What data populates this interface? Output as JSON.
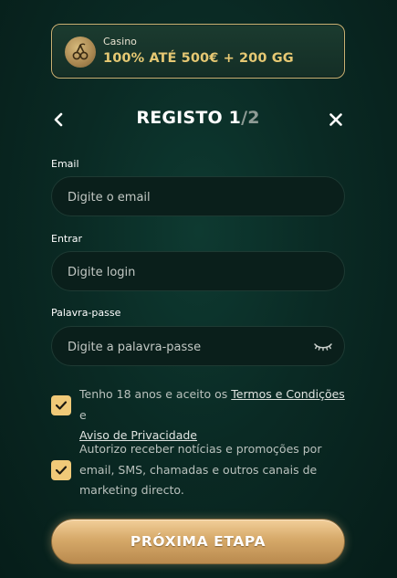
{
  "promo": {
    "caption": "Casino",
    "title": "100% ATÉ 500€ + 200 GG",
    "icon": "cherry-icon"
  },
  "header": {
    "title_step": "REGISTO 1",
    "title_total": "/2",
    "back_icon": "chevron-left-icon",
    "close_icon": "close-icon"
  },
  "form": {
    "email": {
      "label": "Email",
      "placeholder": "Digite o email",
      "value": ""
    },
    "login": {
      "label": "Entrar",
      "placeholder": "Digite login",
      "value": ""
    },
    "password": {
      "label": "Palavra-passe",
      "placeholder": "Digite a palavra-passe",
      "value": "",
      "toggle_icon": "eye-closed-icon"
    }
  },
  "consents": {
    "terms": {
      "checked": true,
      "text_before": "Tenho 18 anos e aceito os ",
      "terms_link": "Termos e Condições",
      "text_between": " e",
      "privacy_link": "Aviso de Privacidade"
    },
    "marketing": {
      "checked": true,
      "text": "Autorizo receber notícias e promoções por email, SMS, chamadas e outros canais de marketing directo."
    }
  },
  "submit": {
    "label": "PRÓXIMA ETAPA"
  },
  "colors": {
    "accent_gold": "#e6c873",
    "checkbox": "#f0c978",
    "background": "#0a2a24"
  }
}
